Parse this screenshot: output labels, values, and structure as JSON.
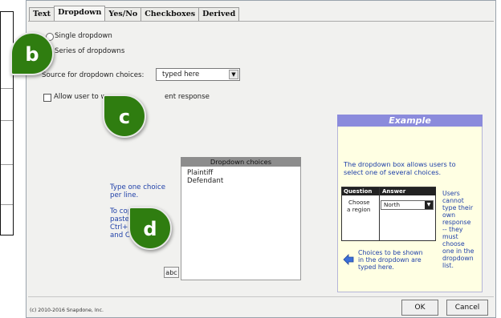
{
  "tabs": [
    "Text",
    "Dropdown",
    "Yes/No",
    "Checkboxes",
    "Derived"
  ],
  "radio_single": "Single dropdown",
  "radio_series": "Series of dropdowns",
  "source_label": "Source for dropdown choices:",
  "source_value": "typed here",
  "allow_label_start": "Allow user to w",
  "allow_label_end": "ent response",
  "instructions": {
    "line1": "Type one choice",
    "line2": "per line.",
    "line3": "To cop",
    "line4": "paste",
    "line5": "Ctrl+",
    "line6": "and C"
  },
  "choices_header": "Dropdown choices",
  "choices": [
    "Plaintiff",
    "Defendant"
  ],
  "abc_button": "abc",
  "example": {
    "title": "Example",
    "desc_line1": "The dropdown box allows users to",
    "desc_line2": "select one of several choices.",
    "th_question": "Question",
    "th_answer": "Answer",
    "cell_q1": "Choose",
    "cell_q2": "a region",
    "cell_a": "North",
    "side_note": [
      "Users",
      "cannot",
      "type their",
      "own",
      "response",
      "-- they",
      "must",
      "choose",
      "one in the",
      "dropdown",
      "list."
    ],
    "hint_line1": "Choices to be shown",
    "hint_line2": "in the dropdown are",
    "hint_line3": "typed here."
  },
  "ok_button": "OK",
  "cancel_button": "Cancel",
  "copyright": "(c) 2010-2016 Snapdone, Inc.",
  "callouts": {
    "b": "b",
    "c": "c",
    "d": "d"
  }
}
